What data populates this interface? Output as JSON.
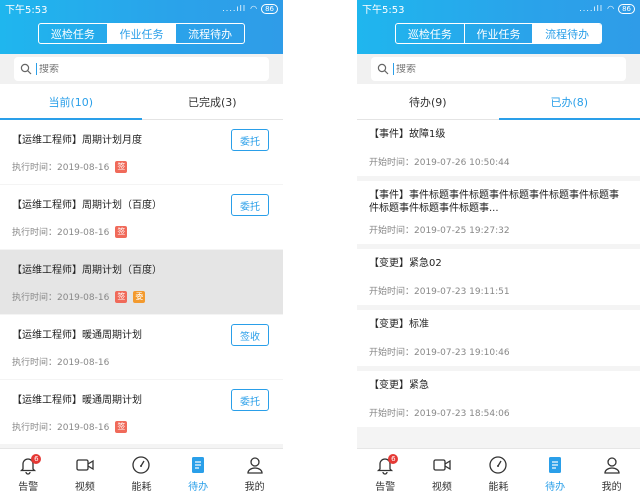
{
  "left": {
    "status": {
      "time": "下午5:53",
      "signal": "....ıll",
      "battery": "86"
    },
    "segments": [
      "巡检任务",
      "作业任务",
      "流程待办"
    ],
    "active_segment": 1,
    "search": {
      "placeholder": "搜索"
    },
    "tabs": [
      "当前(10)",
      "已完成(3)"
    ],
    "items": [
      {
        "title": "【运维工程师】周期计划月度",
        "time": "执行时间：2019-08-16",
        "badges": [
          "签"
        ],
        "button": "委托",
        "highlight": false
      },
      {
        "title": "【运维工程师】周期计划（百度）",
        "time": "执行时间：2019-08-16",
        "badges": [
          "签"
        ],
        "button": "委托",
        "highlight": false
      },
      {
        "title": "【运维工程师】周期计划（百度）",
        "time": "执行时间：2019-08-16",
        "badges": [
          "签",
          "委"
        ],
        "button": "",
        "highlight": true
      },
      {
        "title": "【运维工程师】暖通周期计划",
        "time": "执行时间：2019-08-16",
        "badges": [],
        "button": "签收",
        "highlight": false
      },
      {
        "title": "【运维工程师】暖通周期计划",
        "time": "执行时间：2019-08-16",
        "badges": [
          "签"
        ],
        "button": "委托",
        "highlight": false
      }
    ],
    "nav": [
      {
        "label": "告警",
        "badge": "6"
      },
      {
        "label": "视频"
      },
      {
        "label": "能耗"
      },
      {
        "label": "待办"
      },
      {
        "label": "我的"
      }
    ],
    "active_nav": 3
  },
  "right": {
    "status": {
      "time": "下午5:53",
      "signal": "....ıll",
      "battery": "86"
    },
    "segments": [
      "巡检任务",
      "作业任务",
      "流程待办"
    ],
    "active_segment": 2,
    "search": {
      "placeholder": "搜索"
    },
    "tabs": [
      "待办(9)",
      "已办(8)"
    ],
    "items": [
      {
        "title": "【事件】故障1级",
        "time": "开始时间：2019-07-26 10:50:44"
      },
      {
        "title": "【事件】事件标题事件标题事件标题事件标题事件标题事件标题事件标题事件标题事...",
        "time": "开始时间：2019-07-25 19:27:32"
      },
      {
        "title": "【变更】紧急02",
        "time": "开始时间：2019-07-23 19:11:51"
      },
      {
        "title": "【变更】标准",
        "time": "开始时间：2019-07-23 19:10:46"
      },
      {
        "title": "【变更】紧急",
        "time": "开始时间：2019-07-23 18:54:06"
      }
    ],
    "nav": [
      {
        "label": "告警",
        "badge": "6"
      },
      {
        "label": "视频"
      },
      {
        "label": "能耗"
      },
      {
        "label": "待办"
      },
      {
        "label": "我的"
      }
    ],
    "active_nav": 3
  }
}
